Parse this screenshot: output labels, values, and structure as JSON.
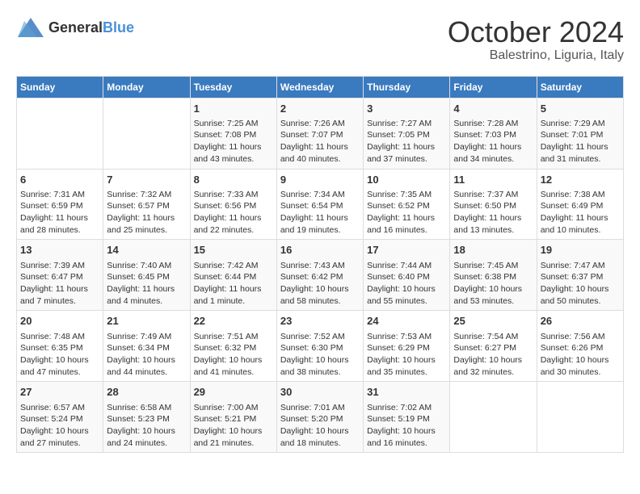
{
  "header": {
    "logo_general": "General",
    "logo_blue": "Blue",
    "month_title": "October 2024",
    "location": "Balestrino, Liguria, Italy"
  },
  "days_of_week": [
    "Sunday",
    "Monday",
    "Tuesday",
    "Wednesday",
    "Thursday",
    "Friday",
    "Saturday"
  ],
  "weeks": [
    [
      {
        "day": "",
        "sunrise": "",
        "sunset": "",
        "daylight": ""
      },
      {
        "day": "",
        "sunrise": "",
        "sunset": "",
        "daylight": ""
      },
      {
        "day": "1",
        "sunrise": "Sunrise: 7:25 AM",
        "sunset": "Sunset: 7:08 PM",
        "daylight": "Daylight: 11 hours and 43 minutes."
      },
      {
        "day": "2",
        "sunrise": "Sunrise: 7:26 AM",
        "sunset": "Sunset: 7:07 PM",
        "daylight": "Daylight: 11 hours and 40 minutes."
      },
      {
        "day": "3",
        "sunrise": "Sunrise: 7:27 AM",
        "sunset": "Sunset: 7:05 PM",
        "daylight": "Daylight: 11 hours and 37 minutes."
      },
      {
        "day": "4",
        "sunrise": "Sunrise: 7:28 AM",
        "sunset": "Sunset: 7:03 PM",
        "daylight": "Daylight: 11 hours and 34 minutes."
      },
      {
        "day": "5",
        "sunrise": "Sunrise: 7:29 AM",
        "sunset": "Sunset: 7:01 PM",
        "daylight": "Daylight: 11 hours and 31 minutes."
      }
    ],
    [
      {
        "day": "6",
        "sunrise": "Sunrise: 7:31 AM",
        "sunset": "Sunset: 6:59 PM",
        "daylight": "Daylight: 11 hours and 28 minutes."
      },
      {
        "day": "7",
        "sunrise": "Sunrise: 7:32 AM",
        "sunset": "Sunset: 6:57 PM",
        "daylight": "Daylight: 11 hours and 25 minutes."
      },
      {
        "day": "8",
        "sunrise": "Sunrise: 7:33 AM",
        "sunset": "Sunset: 6:56 PM",
        "daylight": "Daylight: 11 hours and 22 minutes."
      },
      {
        "day": "9",
        "sunrise": "Sunrise: 7:34 AM",
        "sunset": "Sunset: 6:54 PM",
        "daylight": "Daylight: 11 hours and 19 minutes."
      },
      {
        "day": "10",
        "sunrise": "Sunrise: 7:35 AM",
        "sunset": "Sunset: 6:52 PM",
        "daylight": "Daylight: 11 hours and 16 minutes."
      },
      {
        "day": "11",
        "sunrise": "Sunrise: 7:37 AM",
        "sunset": "Sunset: 6:50 PM",
        "daylight": "Daylight: 11 hours and 13 minutes."
      },
      {
        "day": "12",
        "sunrise": "Sunrise: 7:38 AM",
        "sunset": "Sunset: 6:49 PM",
        "daylight": "Daylight: 11 hours and 10 minutes."
      }
    ],
    [
      {
        "day": "13",
        "sunrise": "Sunrise: 7:39 AM",
        "sunset": "Sunset: 6:47 PM",
        "daylight": "Daylight: 11 hours and 7 minutes."
      },
      {
        "day": "14",
        "sunrise": "Sunrise: 7:40 AM",
        "sunset": "Sunset: 6:45 PM",
        "daylight": "Daylight: 11 hours and 4 minutes."
      },
      {
        "day": "15",
        "sunrise": "Sunrise: 7:42 AM",
        "sunset": "Sunset: 6:44 PM",
        "daylight": "Daylight: 11 hours and 1 minute."
      },
      {
        "day": "16",
        "sunrise": "Sunrise: 7:43 AM",
        "sunset": "Sunset: 6:42 PM",
        "daylight": "Daylight: 10 hours and 58 minutes."
      },
      {
        "day": "17",
        "sunrise": "Sunrise: 7:44 AM",
        "sunset": "Sunset: 6:40 PM",
        "daylight": "Daylight: 10 hours and 55 minutes."
      },
      {
        "day": "18",
        "sunrise": "Sunrise: 7:45 AM",
        "sunset": "Sunset: 6:38 PM",
        "daylight": "Daylight: 10 hours and 53 minutes."
      },
      {
        "day": "19",
        "sunrise": "Sunrise: 7:47 AM",
        "sunset": "Sunset: 6:37 PM",
        "daylight": "Daylight: 10 hours and 50 minutes."
      }
    ],
    [
      {
        "day": "20",
        "sunrise": "Sunrise: 7:48 AM",
        "sunset": "Sunset: 6:35 PM",
        "daylight": "Daylight: 10 hours and 47 minutes."
      },
      {
        "day": "21",
        "sunrise": "Sunrise: 7:49 AM",
        "sunset": "Sunset: 6:34 PM",
        "daylight": "Daylight: 10 hours and 44 minutes."
      },
      {
        "day": "22",
        "sunrise": "Sunrise: 7:51 AM",
        "sunset": "Sunset: 6:32 PM",
        "daylight": "Daylight: 10 hours and 41 minutes."
      },
      {
        "day": "23",
        "sunrise": "Sunrise: 7:52 AM",
        "sunset": "Sunset: 6:30 PM",
        "daylight": "Daylight: 10 hours and 38 minutes."
      },
      {
        "day": "24",
        "sunrise": "Sunrise: 7:53 AM",
        "sunset": "Sunset: 6:29 PM",
        "daylight": "Daylight: 10 hours and 35 minutes."
      },
      {
        "day": "25",
        "sunrise": "Sunrise: 7:54 AM",
        "sunset": "Sunset: 6:27 PM",
        "daylight": "Daylight: 10 hours and 32 minutes."
      },
      {
        "day": "26",
        "sunrise": "Sunrise: 7:56 AM",
        "sunset": "Sunset: 6:26 PM",
        "daylight": "Daylight: 10 hours and 30 minutes."
      }
    ],
    [
      {
        "day": "27",
        "sunrise": "Sunrise: 6:57 AM",
        "sunset": "Sunset: 5:24 PM",
        "daylight": "Daylight: 10 hours and 27 minutes."
      },
      {
        "day": "28",
        "sunrise": "Sunrise: 6:58 AM",
        "sunset": "Sunset: 5:23 PM",
        "daylight": "Daylight: 10 hours and 24 minutes."
      },
      {
        "day": "29",
        "sunrise": "Sunrise: 7:00 AM",
        "sunset": "Sunset: 5:21 PM",
        "daylight": "Daylight: 10 hours and 21 minutes."
      },
      {
        "day": "30",
        "sunrise": "Sunrise: 7:01 AM",
        "sunset": "Sunset: 5:20 PM",
        "daylight": "Daylight: 10 hours and 18 minutes."
      },
      {
        "day": "31",
        "sunrise": "Sunrise: 7:02 AM",
        "sunset": "Sunset: 5:19 PM",
        "daylight": "Daylight: 10 hours and 16 minutes."
      },
      {
        "day": "",
        "sunrise": "",
        "sunset": "",
        "daylight": ""
      },
      {
        "day": "",
        "sunrise": "",
        "sunset": "",
        "daylight": ""
      }
    ]
  ]
}
